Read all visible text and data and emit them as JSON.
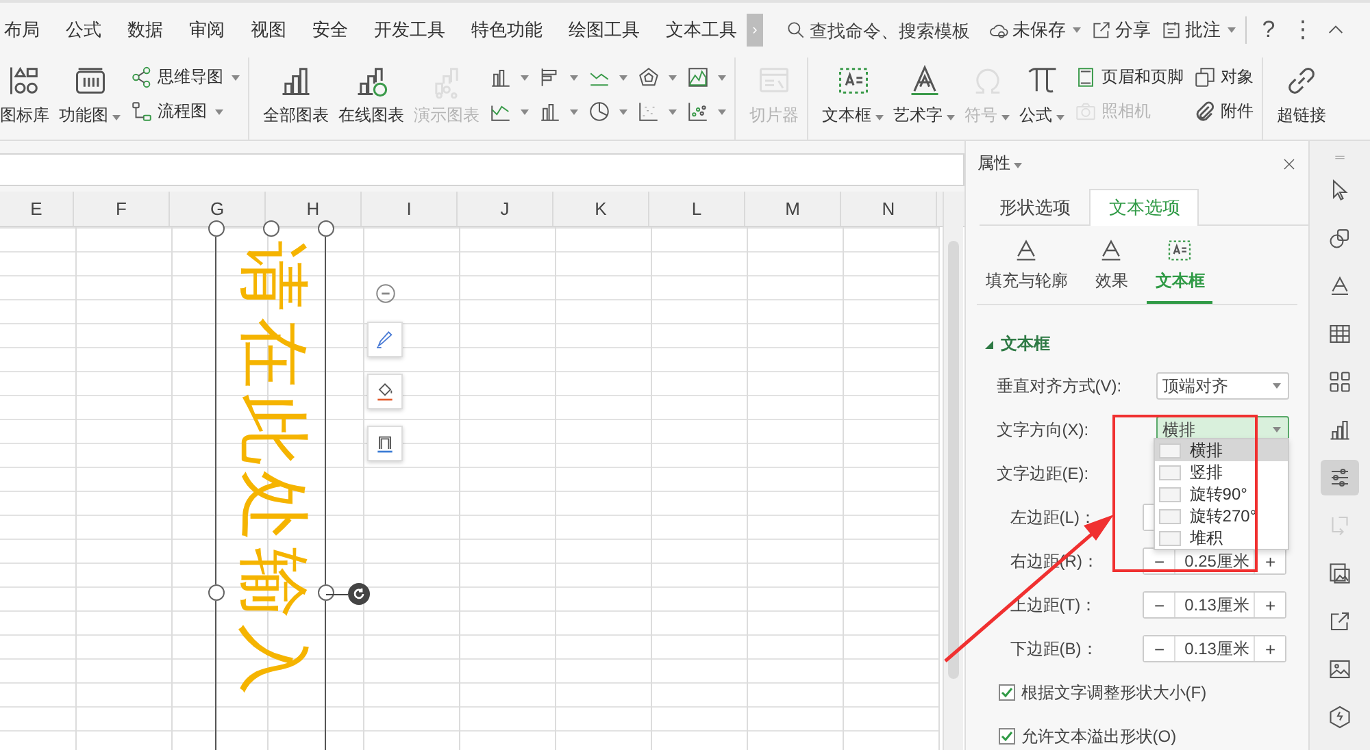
{
  "menu_tabs": [
    {
      "label": "布局"
    },
    {
      "label": "公式"
    },
    {
      "label": "数据"
    },
    {
      "label": "审阅"
    },
    {
      "label": "视图"
    },
    {
      "label": "安全"
    },
    {
      "label": "开发工具"
    },
    {
      "label": "特色功能"
    },
    {
      "label": "绘图工具"
    },
    {
      "label": "文本工具"
    }
  ],
  "menu_scroll": "›",
  "search": {
    "placeholder": "查找命令、搜索模板"
  },
  "top_actions": [
    {
      "label": "未保存",
      "caret": true
    },
    {
      "label": "分享",
      "caret": false
    },
    {
      "label": "批注",
      "caret": true
    }
  ],
  "window_buttons": [
    "?",
    "⋮"
  ],
  "ribbon_groups": [
    {
      "columns": [
        {
          "kind": "big",
          "label": "图标库",
          "caret": false,
          "disabled": false
        },
        {
          "kind": "big",
          "label": "功能图",
          "caret": true,
          "disabled": false
        },
        {
          "kind": "stack",
          "items": [
            {
              "label": "思维导图",
              "caret": true,
              "disabled": false
            },
            {
              "label": "流程图",
              "caret": true,
              "disabled": false
            }
          ]
        }
      ]
    },
    {
      "columns": [
        {
          "kind": "big",
          "label": "全部图表",
          "caret": false,
          "disabled": false
        },
        {
          "kind": "big",
          "label": "在线图表",
          "caret": false,
          "disabled": false
        },
        {
          "kind": "big",
          "label": "演示图表",
          "caret": false,
          "disabled": true
        },
        {
          "kind": "stack",
          "items": [
            {
              "caret": true,
              "disabled": false
            },
            {
              "caret": true,
              "disabled": false
            }
          ]
        },
        {
          "kind": "stack",
          "items": [
            {
              "caret": true,
              "disabled": false
            },
            {
              "caret": true,
              "disabled": false
            }
          ]
        },
        {
          "kind": "stack",
          "items": [
            {
              "caret": true,
              "disabled": false
            },
            {
              "caret": true,
              "disabled": false
            }
          ]
        },
        {
          "kind": "stack",
          "items": [
            {
              "caret": true,
              "disabled": false
            },
            {
              "caret": true,
              "disabled": false
            }
          ]
        },
        {
          "kind": "stack",
          "items": [
            {
              "caret": true,
              "disabled": false
            },
            {
              "caret": true,
              "disabled": false
            }
          ]
        }
      ]
    },
    {
      "columns": [
        {
          "kind": "big",
          "label": "切片器",
          "caret": false,
          "disabled": true
        }
      ]
    },
    {
      "columns": [
        {
          "kind": "big",
          "label": "文本框",
          "caret": true,
          "disabled": false
        },
        {
          "kind": "big",
          "label": "艺术字",
          "caret": true,
          "disabled": false
        },
        {
          "kind": "big",
          "label": "符号",
          "caret": true,
          "disabled": true
        },
        {
          "kind": "big",
          "label": "公式",
          "caret": true,
          "disabled": false
        },
        {
          "kind": "stack",
          "items": [
            {
              "label": "页眉和页脚",
              "caret": false,
              "disabled": false
            },
            {
              "label": "照相机",
              "caret": false,
              "disabled": true
            }
          ]
        },
        {
          "kind": "stack",
          "items": [
            {
              "label": "对象",
              "caret": false,
              "disabled": false
            },
            {
              "label": "附件",
              "caret": false,
              "disabled": false
            }
          ]
        }
      ]
    },
    {
      "columns": [
        {
          "kind": "big",
          "label": "超链接",
          "caret": false,
          "disabled": false
        }
      ]
    }
  ],
  "sheet": {
    "columns": [
      "E",
      "F",
      "G",
      "H",
      "I",
      "J",
      "K",
      "L",
      "M",
      "N"
    ],
    "text_box": {
      "text": "请在此处输入"
    }
  },
  "panel": {
    "title": "属性",
    "tabs": [
      {
        "label": "形状选项",
        "selected": false
      },
      {
        "label": "文本选项",
        "selected": true
      }
    ],
    "subtabs": [
      {
        "label": "填充与轮廓",
        "selected": false
      },
      {
        "label": "效果",
        "selected": false
      },
      {
        "label": "文本框",
        "selected": true
      }
    ],
    "section": {
      "title": "文本框",
      "expanded": true
    },
    "rows": [
      {
        "kind": "select",
        "label": "垂直对齐方式(V):",
        "value": "顶端对齐",
        "open": false
      },
      {
        "kind": "select",
        "label": "文字方向(X):",
        "value": "横排",
        "open": true
      },
      {
        "kind": "heading",
        "label": "文字边距(E):"
      },
      {
        "kind": "stepper",
        "label": "左边距(L)："
      },
      {
        "kind": "stepper",
        "label": "右边距(R)：",
        "minus": "−",
        "value": "0.25厘米",
        "plus": "+"
      },
      {
        "kind": "stepper",
        "label": "上边距(T)：",
        "minus": "−",
        "value": "0.13厘米",
        "plus": "+"
      },
      {
        "kind": "stepper",
        "label": "下边距(B)：",
        "minus": "−",
        "value": "0.13厘米",
        "plus": "+"
      },
      {
        "kind": "checkbox",
        "label": "根据文字调整形状大小(F)",
        "checked": true
      },
      {
        "kind": "checkbox",
        "label": "允许文本溢出形状(O)",
        "checked": true
      }
    ],
    "dropdown": [
      {
        "label": "横排",
        "selected": true
      },
      {
        "label": "竖排",
        "selected": false
      },
      {
        "label": "旋转90°",
        "selected": false
      },
      {
        "label": "旋转270°",
        "selected": false
      },
      {
        "label": "堆积",
        "selected": false
      }
    ]
  },
  "sidebar_tools": [
    {
      "selected": false,
      "disabled": false
    },
    {
      "selected": false,
      "disabled": false
    },
    {
      "selected": false,
      "disabled": false
    },
    {
      "selected": false,
      "disabled": false
    },
    {
      "selected": false,
      "disabled": false
    },
    {
      "selected": false,
      "disabled": false
    },
    {
      "selected": true,
      "disabled": false
    },
    {
      "selected": false,
      "disabled": true
    },
    {
      "selected": false,
      "disabled": false
    },
    {
      "selected": false,
      "disabled": false
    },
    {
      "selected": false,
      "disabled": false
    },
    {
      "selected": false,
      "disabled": false
    }
  ]
}
